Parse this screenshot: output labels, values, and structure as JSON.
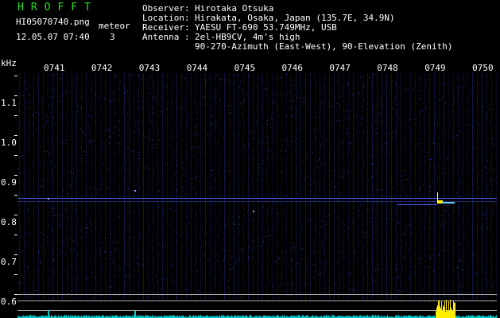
{
  "header": {
    "logo": "HROFFT",
    "filename": "HI05070740.png",
    "datetime": "12.05.07 07:40",
    "meteor_label": "meteor",
    "meteor_count": "3"
  },
  "station": {
    "observer_key": "Observer",
    "observer_val": "Hirotaka Otsuka",
    "location_key": "Location",
    "location_val": "Hirakata, Osaka, Japan (135.7E, 34.9N)",
    "receiver_key": "Receiver",
    "receiver_val": "YAESU FT-690 53.749MHz, USB",
    "antenna_key": "Antenna",
    "antenna_val": "2el-HB9CV, 4m's high",
    "antenna_val2": "90-270-Azimuth (East-West), 90-Elevation (Zenith)"
  },
  "axes": {
    "y_unit": "kHz",
    "x_ticks": [
      "0741",
      "0742",
      "0743",
      "0744",
      "0745",
      "0746",
      "0747",
      "0748",
      "0749",
      "0750"
    ],
    "y_ticks": [
      "1.1",
      "1.0",
      "0.9",
      "0.8",
      "0.7",
      "0.6"
    ]
  },
  "colors": {
    "background": "#000000",
    "logo": "#22dd22",
    "text": "#ffffff",
    "noise": "#2a3aa8",
    "signal": "#ffee00",
    "spectrum": "#00cccc"
  }
}
